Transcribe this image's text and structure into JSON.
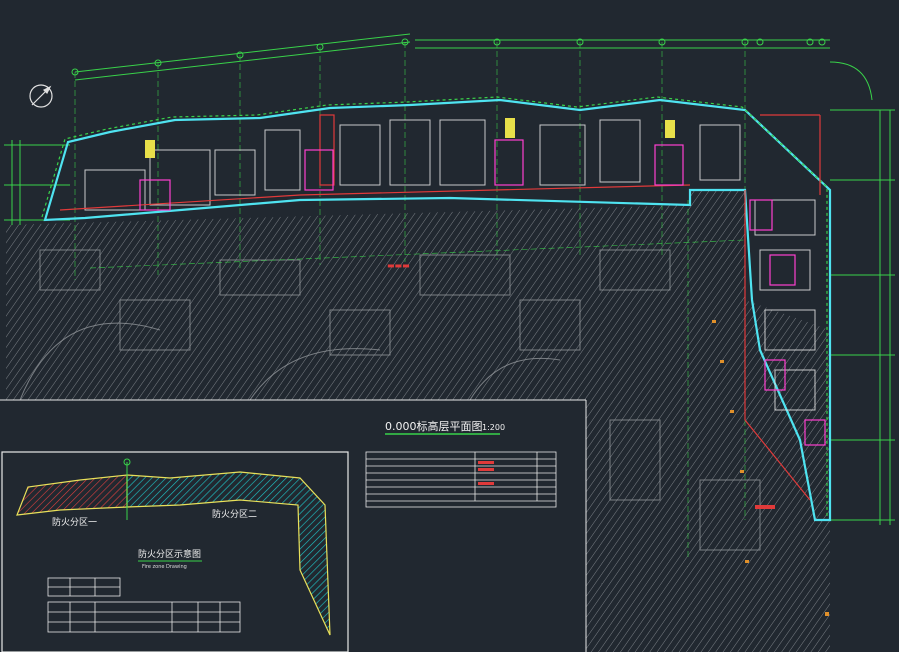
{
  "drawing": {
    "title": "0.000标高层平面图",
    "scale": "1:200",
    "red_tag": "▬▬▬"
  },
  "inset": {
    "title": "防火分区示意图",
    "subtitle": "Fire zone Drawing",
    "zone_one": "防火分区一",
    "zone_two": "防火分区二"
  },
  "colors": {
    "background": "#212830",
    "wall_cyan": "#4fe3f0",
    "grid_green": "#39d24a",
    "accent_red": "#e03a3a",
    "hatch_gray": "#7d8288",
    "zone_one_fill": "#c0392b",
    "zone_two_fill": "#17a5a8",
    "zone_outline": "#e8e05a"
  }
}
